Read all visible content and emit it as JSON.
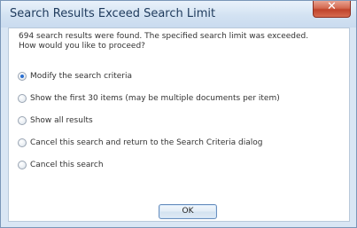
{
  "dialog": {
    "title": "Search Results Exceed Search Limit",
    "message_line1": "694 search results were found. The specified search limit was exceeded.",
    "message_line2": "How would you like to proceed?",
    "close_icon": "close-icon",
    "close_glyph": "✕"
  },
  "options": [
    {
      "label": "Modify the search criteria",
      "checked": true
    },
    {
      "label": "Show the first 30 items (may be multiple documents per item)",
      "checked": false
    },
    {
      "label": "Show all results",
      "checked": false
    },
    {
      "label": "Cancel this search and return to the Search Criteria dialog",
      "checked": false
    },
    {
      "label": "Cancel this search",
      "checked": false
    }
  ],
  "buttons": {
    "ok_label": "OK"
  },
  "colors": {
    "accent": "#2a6fd0",
    "close_button": "#c0432b",
    "frame": "#d9e6f4"
  }
}
